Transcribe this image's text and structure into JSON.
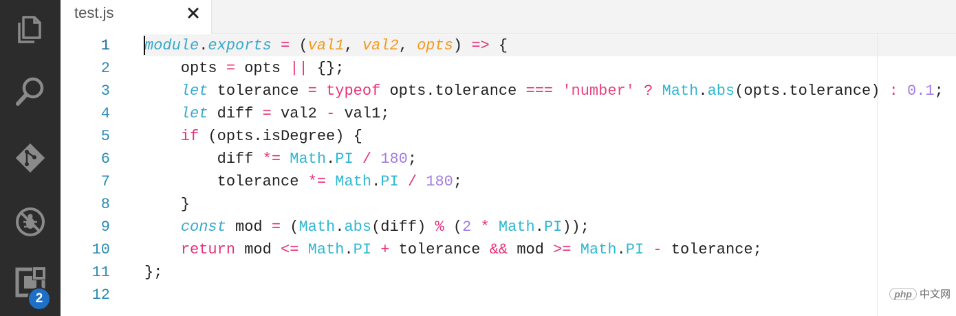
{
  "tab": {
    "title": "test.js",
    "close_icon": "close-icon"
  },
  "activity_bar": {
    "items": [
      {
        "icon": "files-icon"
      },
      {
        "icon": "search-icon"
      },
      {
        "icon": "git-icon"
      },
      {
        "icon": "debug-icon"
      },
      {
        "icon": "extensions-icon",
        "badge": "2"
      }
    ]
  },
  "editor": {
    "lines": [
      {
        "number": "1",
        "tokens": [
          [
            "t-kw-i",
            "module"
          ],
          [
            "t-plain",
            "."
          ],
          [
            "t-kw-i",
            "exports"
          ],
          [
            "t-plain",
            " "
          ],
          [
            "t-op",
            "="
          ],
          [
            "t-plain",
            " ("
          ],
          [
            "t-param",
            "val1"
          ],
          [
            "t-plain",
            ", "
          ],
          [
            "t-param",
            "val2"
          ],
          [
            "t-plain",
            ", "
          ],
          [
            "t-param",
            "opts"
          ],
          [
            "t-plain",
            ") "
          ],
          [
            "t-op",
            "=>"
          ],
          [
            "t-plain",
            " {"
          ]
        ]
      },
      {
        "number": "2",
        "tokens": [
          [
            "t-plain",
            "    opts "
          ],
          [
            "t-op",
            "="
          ],
          [
            "t-plain",
            " opts "
          ],
          [
            "t-op",
            "||"
          ],
          [
            "t-plain",
            " {};"
          ]
        ]
      },
      {
        "number": "3",
        "tokens": [
          [
            "t-plain",
            "    "
          ],
          [
            "t-kw-i",
            "let"
          ],
          [
            "t-plain",
            " tolerance "
          ],
          [
            "t-op",
            "="
          ],
          [
            "t-plain",
            " "
          ],
          [
            "t-kw",
            "typeof"
          ],
          [
            "t-plain",
            " opts.tolerance "
          ],
          [
            "t-op",
            "==="
          ],
          [
            "t-plain",
            " "
          ],
          [
            "t-str",
            "'number'"
          ],
          [
            "t-plain",
            " "
          ],
          [
            "t-op",
            "?"
          ],
          [
            "t-plain",
            " "
          ],
          [
            "t-builtin",
            "Math"
          ],
          [
            "t-plain",
            "."
          ],
          [
            "t-builtin",
            "abs"
          ],
          [
            "t-plain",
            "(opts.tolerance) "
          ],
          [
            "t-op",
            ":"
          ],
          [
            "t-plain",
            " "
          ],
          [
            "t-num",
            "0.1"
          ],
          [
            "t-plain",
            ";"
          ]
        ]
      },
      {
        "number": "4",
        "tokens": [
          [
            "t-plain",
            "    "
          ],
          [
            "t-kw-i",
            "let"
          ],
          [
            "t-plain",
            " diff "
          ],
          [
            "t-op",
            "="
          ],
          [
            "t-plain",
            " val2 "
          ],
          [
            "t-op",
            "-"
          ],
          [
            "t-plain",
            " val1;"
          ]
        ]
      },
      {
        "number": "5",
        "tokens": [
          [
            "t-plain",
            "    "
          ],
          [
            "t-kw",
            "if"
          ],
          [
            "t-plain",
            " (opts.isDegree) {"
          ]
        ]
      },
      {
        "number": "6",
        "tokens": [
          [
            "t-plain",
            "        diff "
          ],
          [
            "t-op",
            "*="
          ],
          [
            "t-plain",
            " "
          ],
          [
            "t-builtin",
            "Math"
          ],
          [
            "t-plain",
            "."
          ],
          [
            "t-builtin",
            "PI"
          ],
          [
            "t-plain",
            " "
          ],
          [
            "t-op",
            "/"
          ],
          [
            "t-plain",
            " "
          ],
          [
            "t-num",
            "180"
          ],
          [
            "t-plain",
            ";"
          ]
        ]
      },
      {
        "number": "7",
        "tokens": [
          [
            "t-plain",
            "        tolerance "
          ],
          [
            "t-op",
            "*="
          ],
          [
            "t-plain",
            " "
          ],
          [
            "t-builtin",
            "Math"
          ],
          [
            "t-plain",
            "."
          ],
          [
            "t-builtin",
            "PI"
          ],
          [
            "t-plain",
            " "
          ],
          [
            "t-op",
            "/"
          ],
          [
            "t-plain",
            " "
          ],
          [
            "t-num",
            "180"
          ],
          [
            "t-plain",
            ";"
          ]
        ]
      },
      {
        "number": "8",
        "tokens": [
          [
            "t-plain",
            "    }"
          ]
        ]
      },
      {
        "number": "9",
        "tokens": [
          [
            "t-plain",
            "    "
          ],
          [
            "t-kw-i",
            "const"
          ],
          [
            "t-plain",
            " mod "
          ],
          [
            "t-op",
            "="
          ],
          [
            "t-plain",
            " ("
          ],
          [
            "t-builtin",
            "Math"
          ],
          [
            "t-plain",
            "."
          ],
          [
            "t-builtin",
            "abs"
          ],
          [
            "t-plain",
            "(diff) "
          ],
          [
            "t-op",
            "%"
          ],
          [
            "t-plain",
            " ("
          ],
          [
            "t-num",
            "2"
          ],
          [
            "t-plain",
            " "
          ],
          [
            "t-op",
            "*"
          ],
          [
            "t-plain",
            " "
          ],
          [
            "t-builtin",
            "Math"
          ],
          [
            "t-plain",
            "."
          ],
          [
            "t-builtin",
            "PI"
          ],
          [
            "t-plain",
            "));"
          ]
        ]
      },
      {
        "number": "10",
        "tokens": [
          [
            "t-plain",
            "    "
          ],
          [
            "t-kw",
            "return"
          ],
          [
            "t-plain",
            " mod "
          ],
          [
            "t-op",
            "<="
          ],
          [
            "t-plain",
            " "
          ],
          [
            "t-builtin",
            "Math"
          ],
          [
            "t-plain",
            "."
          ],
          [
            "t-builtin",
            "PI"
          ],
          [
            "t-plain",
            " "
          ],
          [
            "t-op",
            "+"
          ],
          [
            "t-plain",
            " tolerance "
          ],
          [
            "t-op",
            "&&"
          ],
          [
            "t-plain",
            " mod "
          ],
          [
            "t-op",
            ">="
          ],
          [
            "t-plain",
            " "
          ],
          [
            "t-builtin",
            "Math"
          ],
          [
            "t-plain",
            "."
          ],
          [
            "t-builtin",
            "PI"
          ],
          [
            "t-plain",
            " "
          ],
          [
            "t-op",
            "-"
          ],
          [
            "t-plain",
            " tolerance;"
          ]
        ]
      },
      {
        "number": "11",
        "tokens": [
          [
            "t-plain",
            "};"
          ]
        ]
      },
      {
        "number": "12",
        "tokens": []
      }
    ]
  },
  "watermark": {
    "logo": "php",
    "text": "中文网"
  }
}
